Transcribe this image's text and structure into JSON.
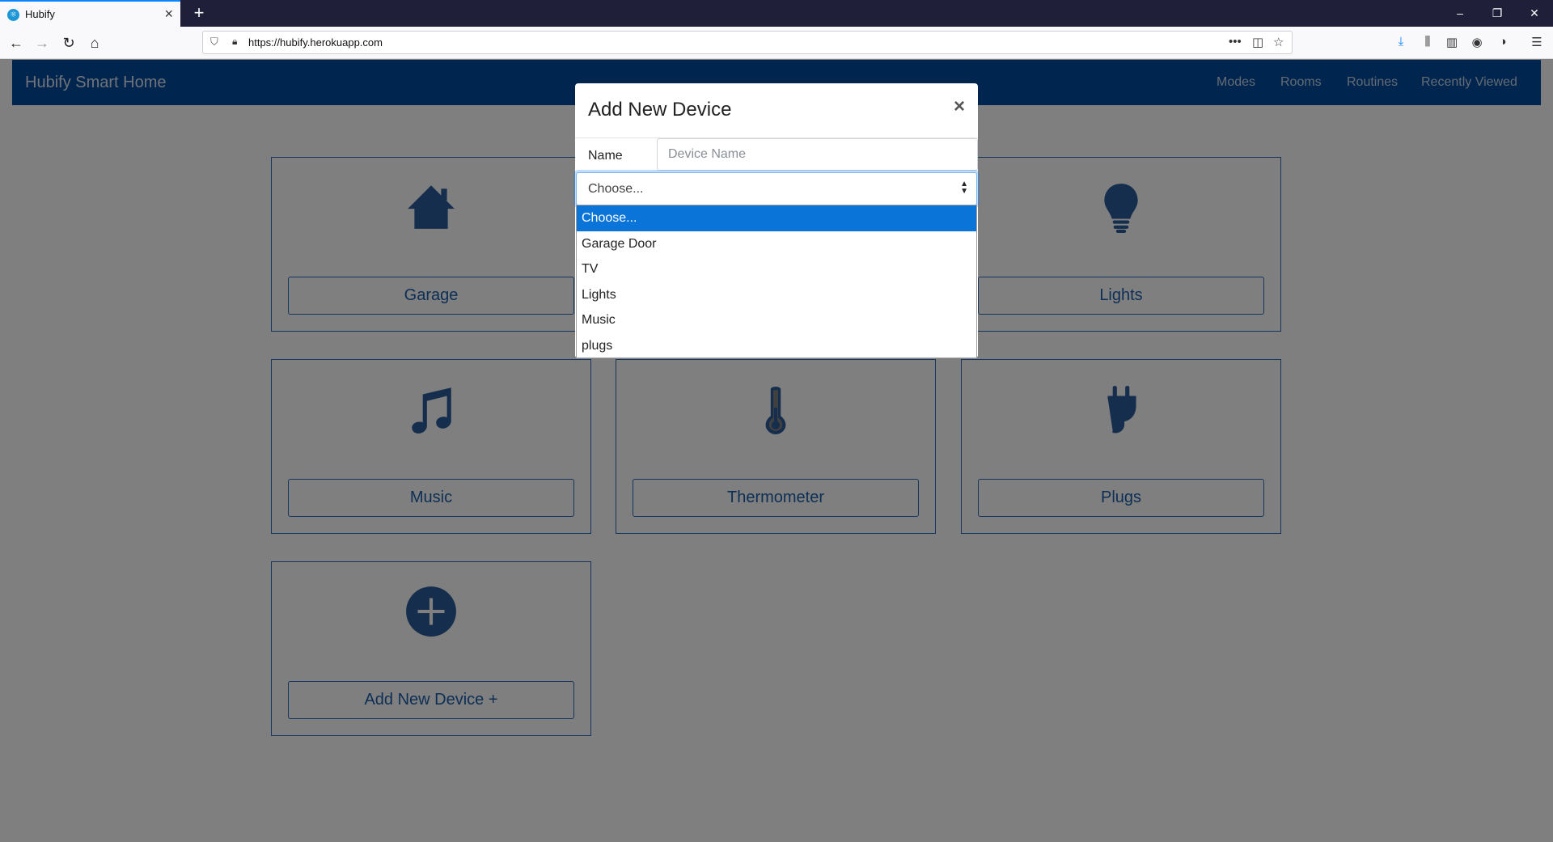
{
  "browser": {
    "tab_title": "Hubify",
    "url": "https://hubify.herokuapp.com",
    "window_controls": [
      "minimize-icon",
      "restore-icon",
      "close-icon"
    ]
  },
  "app": {
    "brand": "Hubify Smart Home",
    "nav": [
      "Modes",
      "Rooms",
      "Routines",
      "Recently Viewed"
    ]
  },
  "devices": [
    {
      "label": "Garage",
      "icon": "house-icon"
    },
    {
      "label": "Lights",
      "icon": "lightbulb-icon"
    },
    {
      "label": "Music",
      "icon": "music-note-icon"
    },
    {
      "label": "Thermometer",
      "icon": "thermometer-icon"
    },
    {
      "label": "Plugs",
      "icon": "plug-icon"
    },
    {
      "label": "Add New Device +",
      "icon": "plus-circle-icon"
    }
  ],
  "modal": {
    "title": "Add New Device",
    "close": "×",
    "name_label": "Name",
    "name_placeholder": "Device Name",
    "select_value": "Choose...",
    "options": [
      "Choose...",
      "Garage Door",
      "TV",
      "Lights",
      "Music",
      "plugs"
    ],
    "selected_option": "Choose..."
  },
  "colors": {
    "navbar": "#004b9e",
    "accent": "#2a6ab8",
    "selected": "#0a74d9"
  }
}
